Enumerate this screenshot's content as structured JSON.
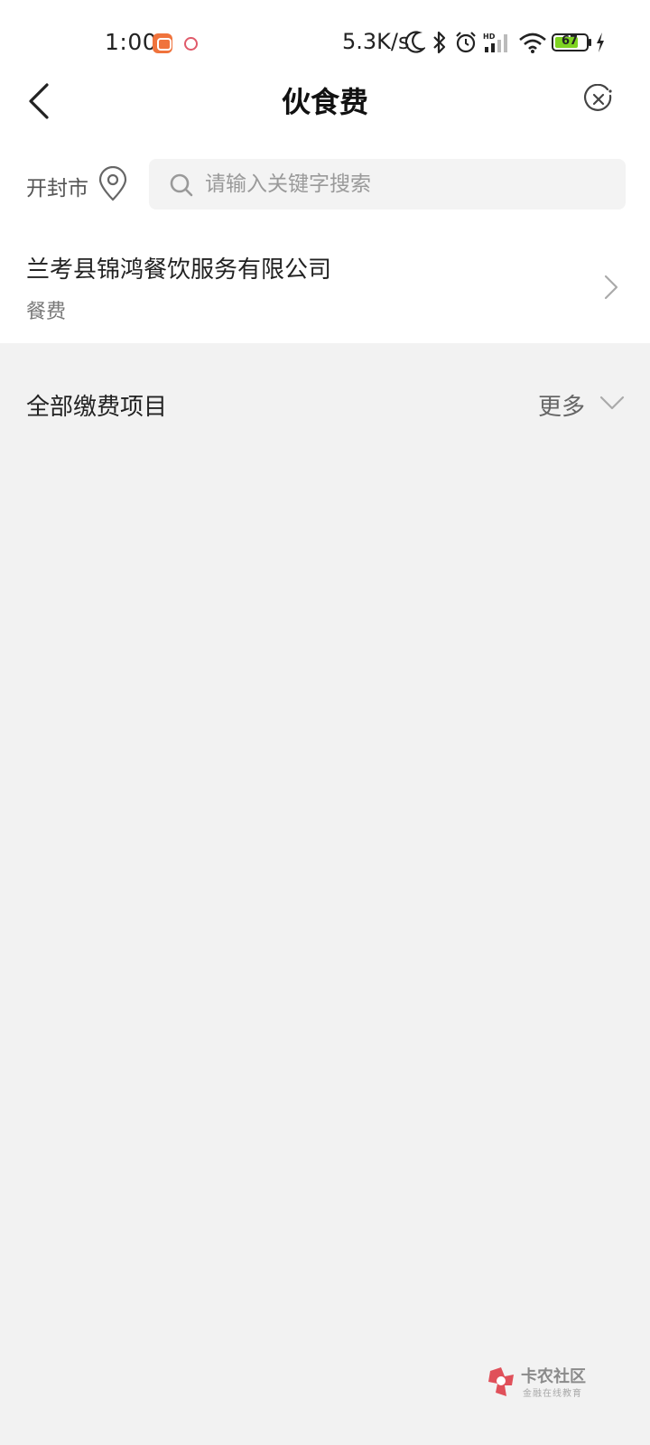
{
  "status_bar": {
    "time": "1:00",
    "net_speed": "5.3K/s",
    "battery": "67",
    "icons": [
      "app-notification-icon",
      "app-notification-icon",
      "moon-icon",
      "bluetooth-icon",
      "alarm-icon",
      "signal-icon",
      "wifi-icon",
      "battery-icon",
      "charging-icon"
    ]
  },
  "header": {
    "title": "伙食费",
    "back_icon": "chevron-left-icon",
    "close_icon": "close-circle-icon"
  },
  "location": {
    "city": "开封市",
    "icon": "location-pin-icon"
  },
  "search": {
    "placeholder": "请输入关键字搜索",
    "value": ""
  },
  "merchant": {
    "name": "兰考县锦鸿餐饮服务有限公司",
    "category": "餐费"
  },
  "section": {
    "title": "全部缴费项目",
    "more_label": "更多"
  },
  "watermark": {
    "title": "卡农社区",
    "subtitle": "金融在线教育"
  },
  "colors": {
    "page_bg": "#f2f2f2",
    "card_bg": "#ffffff",
    "battery_fill": "#7ed321",
    "watermark_red": "#e0505a"
  }
}
